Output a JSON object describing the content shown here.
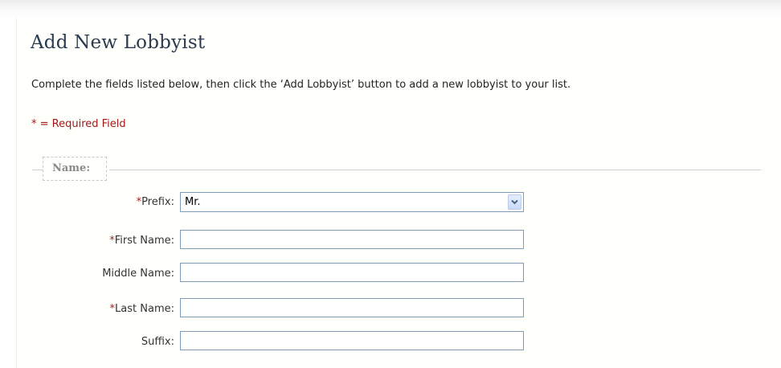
{
  "page": {
    "title": "Add New Lobbyist",
    "instructions": "Complete the fields listed below, then click the ‘Add Lobbyist’ button to add a new lobbyist to your list.",
    "required_note": "* = Required Field"
  },
  "fieldset": {
    "legend": "Name:"
  },
  "fields": {
    "prefix": {
      "star": "*",
      "label": "Prefix:",
      "selected_value": "Mr."
    },
    "first_name": {
      "star": "*",
      "label": "First Name:",
      "value": ""
    },
    "middle_name": {
      "label": "Middle Name:",
      "value": ""
    },
    "last_name": {
      "star": "*",
      "label": "Last Name:",
      "value": ""
    },
    "suffix": {
      "label": "Suffix:",
      "value": ""
    }
  },
  "icons": {
    "dropdown": "chevron-down-icon"
  },
  "colors": {
    "title": "#2b3b50",
    "required": "#a01818",
    "input_border": "#7f9db9",
    "panel_background": "#fffffb"
  }
}
